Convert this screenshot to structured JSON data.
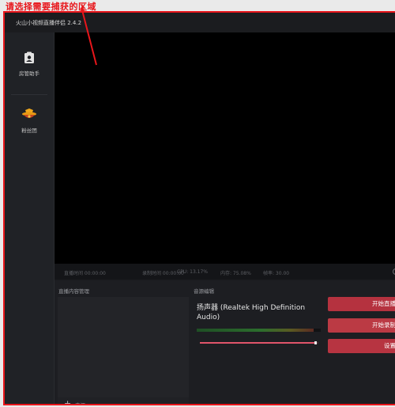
{
  "annotation": {
    "text": "请选择需要捕获的区域"
  },
  "window": {
    "title": "火山小视频直播伴侣 2.4.2"
  },
  "sidebar": {
    "items": [
      {
        "label": "房管助手",
        "icon": "clipboard-person-icon"
      },
      {
        "label": "粉丝团",
        "icon": "fan-club-badge-icon"
      }
    ]
  },
  "status": {
    "live_time": "直播时间 00:00:00",
    "record_time": "录制时间 00:00:00",
    "cpu": "CPU: 13.17%",
    "memory": "内存: 75.08%",
    "fps": "帧率: 30.00"
  },
  "sources": {
    "title": "直播内容管理",
    "add_label": "来源"
  },
  "audio": {
    "title": "音源编辑",
    "device_name": "扬声器 (Realtek High Definition Audio)",
    "meter_level": 0.94,
    "volume_level": 0.98
  },
  "actions": {
    "start_stream": "开始直播",
    "start_record": "开始录制",
    "settings": "设置"
  },
  "colors": {
    "accent": "#b73241",
    "annotation": "#e8161b"
  }
}
